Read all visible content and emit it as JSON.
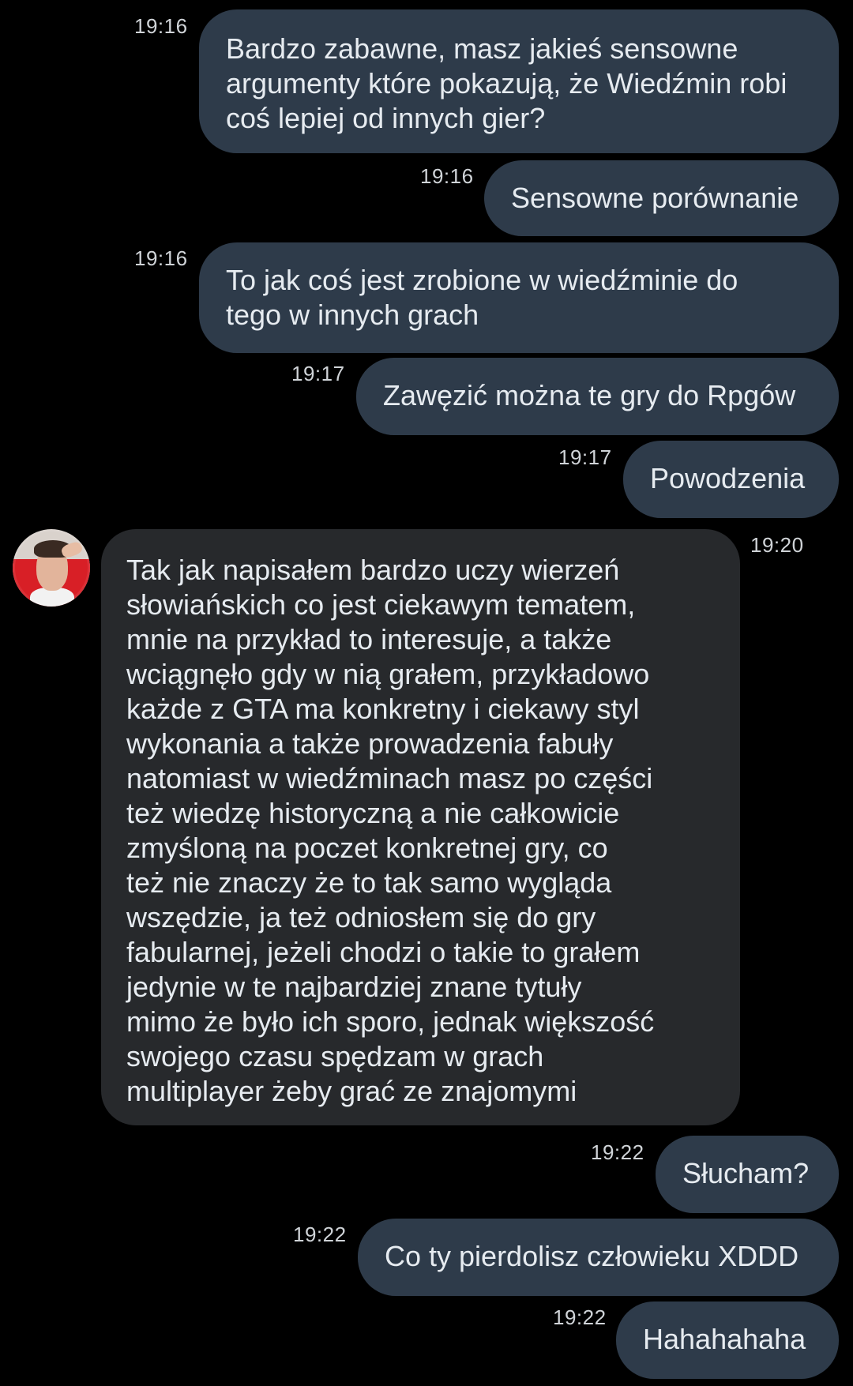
{
  "colors": {
    "background": "#000000",
    "outgoing_bubble": "#2e3b4a",
    "incoming_bubble": "#27292c",
    "text": "#e6ebf0",
    "timestamp": "#d0d4d8"
  },
  "messages": [
    {
      "direction": "outgoing",
      "time": "19:16",
      "lines": [
        "Bardzo zabawne, masz jakieś sensowne",
        "argumenty które pokazują, że Wiedźmin robi",
        "coś lepiej od innych gier?"
      ]
    },
    {
      "direction": "outgoing",
      "time": "19:16",
      "lines": [
        "Sensowne porównanie"
      ]
    },
    {
      "direction": "outgoing",
      "time": "19:16",
      "lines": [
        "To jak coś jest zrobione w wiedźminie do",
        "tego w innych grach"
      ]
    },
    {
      "direction": "outgoing",
      "time": "19:17",
      "lines": [
        "Zawęzić można te gry do Rpgów"
      ]
    },
    {
      "direction": "outgoing",
      "time": "19:17",
      "lines": [
        "Powodzenia"
      ]
    },
    {
      "direction": "incoming",
      "time": "19:20",
      "avatar": "contact-avatar",
      "lines": [
        "Tak jak napisałem bardzo uczy wierzeń",
        "słowiańskich co jest ciekawym tematem,",
        "mnie na przykład to interesuje, a także",
        "wciągnęło gdy w nią grałem, przykładowo",
        "każde z GTA ma konkretny i ciekawy styl",
        "wykonania a także prowadzenia fabuły",
        "natomiast w wiedźminach masz po części",
        "też wiedzę historyczną a nie całkowicie",
        "zmyśloną na poczet konkretnej gry, co",
        "też nie znaczy że to tak samo wygląda",
        "wszędzie, ja też odniosłem się do gry",
        "fabularnej, jeżeli chodzi o takie to grałem",
        "jedynie w te najbardziej znane tytuły",
        "mimo że było ich sporo, jednak większość",
        "swojego czasu spędzam w grach",
        "multiplayer żeby grać ze znajomymi"
      ]
    },
    {
      "direction": "outgoing",
      "time": "19:22",
      "lines": [
        "Słucham?"
      ]
    },
    {
      "direction": "outgoing",
      "time": "19:22",
      "lines": [
        "Co ty pierdolisz człowieku XDDD"
      ]
    },
    {
      "direction": "outgoing",
      "time": "19:22",
      "lines": [
        "Hahahahaha"
      ]
    }
  ]
}
